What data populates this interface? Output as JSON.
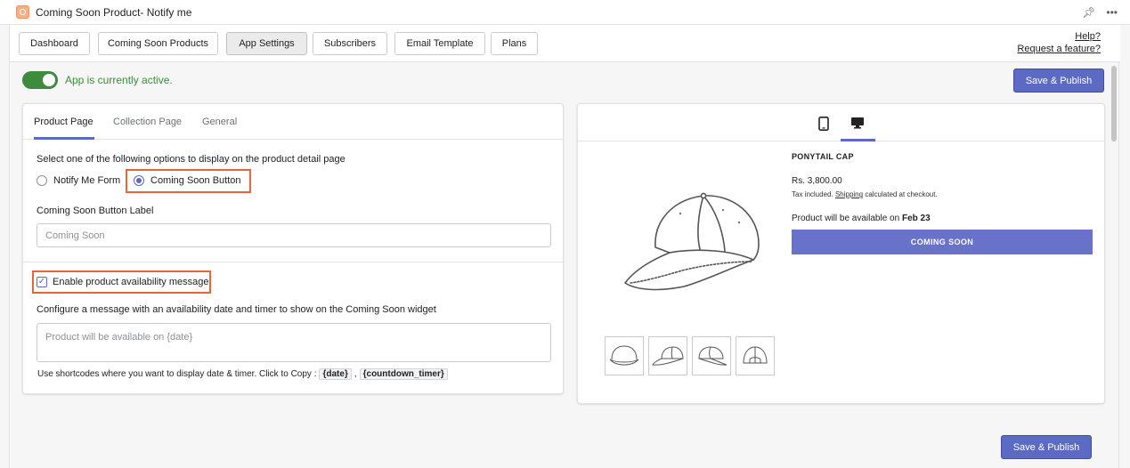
{
  "window": {
    "title": "Coming Soon Product- Notify me",
    "pin_icon": "pin-icon",
    "more_icon": "more-icon"
  },
  "nav": {
    "tabs": [
      "Dashboard",
      "Coming Soon Products",
      "App Settings",
      "Subscribers",
      "Email Template",
      "Plans"
    ],
    "active_tab": "App Settings",
    "help": "Help?",
    "request": "Request a feature?"
  },
  "status": {
    "text": "App is currently active.",
    "active": true,
    "color": "#3f8b3f"
  },
  "save_label": "Save & Publish",
  "settings": {
    "tabs": [
      "Product Page",
      "Collection Page",
      "General"
    ],
    "active_tab": "Product Page",
    "prompt": "Select one of the following options to display on the product detail page",
    "options": [
      "Notify Me Form",
      "Coming Soon Button"
    ],
    "selected_option": "Coming Soon Button",
    "button_label_title": "Coming Soon Button Label",
    "button_label_placeholder": "Coming Soon",
    "enable_label": "Enable product availability message",
    "enable_checked": true,
    "configure_text": "Configure a message with an availability date and timer to show on the Coming Soon widget",
    "message_placeholder": "Product will be available on {date}",
    "shortcode_hint": "Use shortcodes where you want to display date & timer. Click to Copy :",
    "shortcodes": [
      "{date}",
      "{countdown_timer}"
    ],
    "shortcode_separator": ","
  },
  "preview": {
    "devices": [
      "mobile-icon",
      "desktop-icon"
    ],
    "active_device": "desktop-icon",
    "product_title": "PONYTAIL CAP",
    "price": "Rs. 3,800.00",
    "tax_prefix": "Tax included.",
    "tax_link": "Shipping",
    "tax_suffix": "calculated at checkout.",
    "availability_prefix": "Product will be available on",
    "availability_date": "Feb 23",
    "button": "COMING SOON",
    "thumbnails": [
      "cap-front",
      "cap-side",
      "cap-three-quarter",
      "cap-back"
    ]
  },
  "colors": {
    "accent": "#5c6ac4",
    "highlight": "#e5663d",
    "toggle": "#3d8b3d"
  }
}
